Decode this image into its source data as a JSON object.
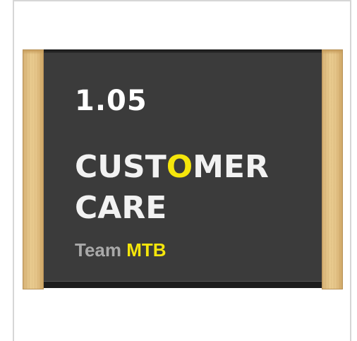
{
  "sign": {
    "room_number": "1.05",
    "title_line1_part1": "CUST",
    "title_line1_accent": "O",
    "title_line1_part2": "MER",
    "title_line2": "CARE",
    "team_label": "Team",
    "team_name": "MTB"
  },
  "colors": {
    "panel": "#3b3b3b",
    "accent": "#f5e60b",
    "text_primary": "#f2f2f2",
    "text_muted": "#a9a9a9",
    "wood": "#e4c387"
  }
}
